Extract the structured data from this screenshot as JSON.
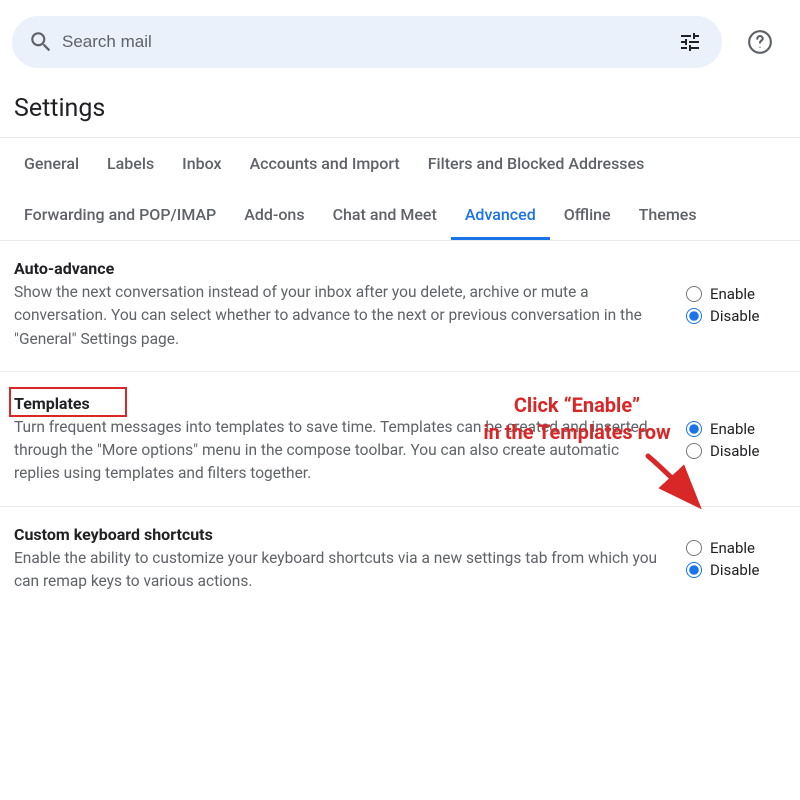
{
  "search": {
    "placeholder": "Search mail"
  },
  "page_title": "Settings",
  "tabs": [
    "General",
    "Labels",
    "Inbox",
    "Accounts and Import",
    "Filters and Blocked Addresses",
    "Forwarding and POP/IMAP",
    "Add-ons",
    "Chat and Meet",
    "Advanced",
    "Offline",
    "Themes"
  ],
  "active_tab": "Advanced",
  "radio_labels": {
    "enable": "Enable",
    "disable": "Disable"
  },
  "rows": {
    "auto_advance": {
      "title": "Auto-advance",
      "text": "Show the next conversation instead of your inbox after you delete, archive or mute a conversation. You can select whether to advance to the next or previous conversation in the \"General\" Settings page.",
      "selected": "disable"
    },
    "templates": {
      "title": "Templates",
      "text": "Turn frequent messages into templates to save time. Templates can be created and inserted through the \"More options\" menu in the compose toolbar. You can also create automatic replies using templates and filters together.",
      "selected": "enable"
    },
    "custom_keyboard": {
      "title": "Custom keyboard shortcuts",
      "text": "Enable the ability to customize your keyboard shortcuts via a new settings tab from which you can remap keys to various actions.",
      "selected": "disable"
    }
  },
  "annotation": {
    "line1": "Click “Enable”",
    "line2": "in the Templates row"
  }
}
